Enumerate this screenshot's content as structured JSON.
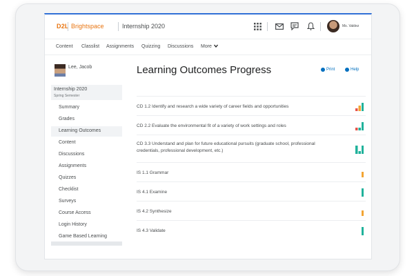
{
  "brand": {
    "d2l": "D2L",
    "product": "Brightspace",
    "course": "Internship 2020"
  },
  "header": {
    "icons": [
      "grid-icon",
      "mail-icon",
      "chat-icon",
      "bell-icon"
    ],
    "user_name": "Ms. Valdez"
  },
  "nav": {
    "items": [
      "Content",
      "Classlist",
      "Assignments",
      "Quizzing",
      "Discussions"
    ],
    "more_label": "More",
    "more_icon": "chevron-down-icon"
  },
  "student": {
    "name": "Lee, Jacob",
    "course": "Internship 2020",
    "semester": "Spring Semester"
  },
  "sidebar": {
    "items": [
      {
        "label": "Summary",
        "active": false
      },
      {
        "label": "Grades",
        "active": false
      },
      {
        "label": "Learning Outcomes",
        "active": true
      },
      {
        "label": "Content",
        "active": false
      },
      {
        "label": "Discussions",
        "active": false
      },
      {
        "label": "Assignments",
        "active": false
      },
      {
        "label": "Quizzes",
        "active": false
      },
      {
        "label": "Checklist",
        "active": false
      },
      {
        "label": "Surveys",
        "active": false
      },
      {
        "label": "Course Access",
        "active": false
      },
      {
        "label": "Login History",
        "active": false
      },
      {
        "label": "Game Based Learning",
        "active": false
      }
    ]
  },
  "main": {
    "title": "Learning Outcomes Progress",
    "print_label": "Print",
    "help_label": "Help",
    "outcomes": [
      {
        "text": "CD 1.2 Identify and research a wide variety of career fields and opportunities",
        "indicator": "bars",
        "bars": [
          1,
          2,
          3
        ],
        "colors": [
          "#e8534a",
          "#f3a533",
          "#20b29b"
        ]
      },
      {
        "text": "CD 2.2 Evaluate the environmental fit of a variety of work settings and roles",
        "indicator": "bars",
        "bars": [
          1,
          1,
          3
        ],
        "colors": [
          "#e8534a",
          "#20b29b",
          "#20b29b"
        ]
      },
      {
        "text": "CD 3.3 Understand and plan for future educational pursuits (graduate school, professional credentials, professional development, etc.)",
        "indicator": "bars",
        "bars": [
          3,
          1,
          3
        ],
        "colors": [
          "#20b29b",
          "#20b29b",
          "#20b29b"
        ]
      },
      {
        "text": "IS 1.1 Grammar",
        "indicator": "single",
        "bars": [
          2
        ],
        "colors": [
          "#f3a533"
        ]
      },
      {
        "text": "IS 4.1 Examine",
        "indicator": "single",
        "bars": [
          3
        ],
        "colors": [
          "#20b29b"
        ]
      },
      {
        "text": "IS 4.2 Synthesize",
        "indicator": "single",
        "bars": [
          2
        ],
        "colors": [
          "#f3a533"
        ]
      },
      {
        "text": "IS 4.3 Validate",
        "indicator": "single",
        "bars": [
          3
        ],
        "colors": [
          "#20b29b"
        ]
      }
    ]
  },
  "colors": {
    "brand": "#e87511",
    "accent": "#2f6fd6",
    "link": "#006fbf"
  }
}
